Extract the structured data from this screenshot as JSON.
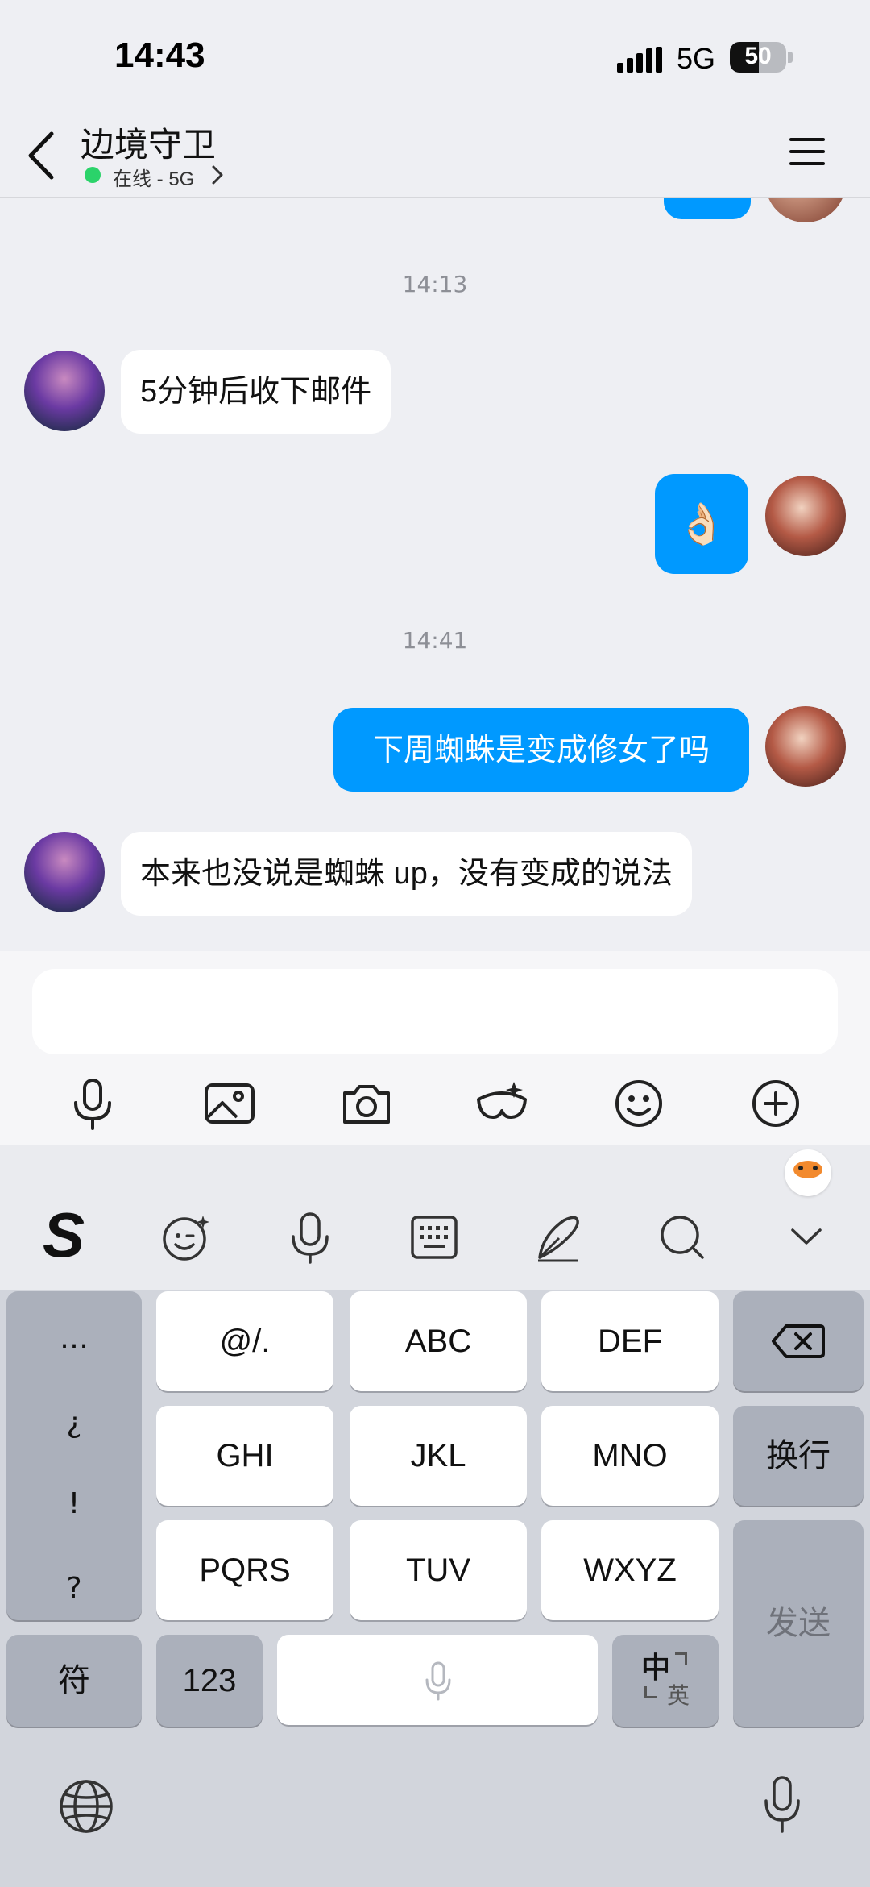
{
  "status": {
    "time": "14:43",
    "network": "5G",
    "battery": "50"
  },
  "header": {
    "title": "边境守卫",
    "status_text": "在线 - 5G"
  },
  "chat": {
    "time1": "14:13",
    "msg1": "5分钟后收下邮件",
    "msg2": "👌🏻",
    "time2": "14:41",
    "msg3": "下周蜘蛛是变成修女了吗",
    "msg4": "本来也没说是蜘蛛 up，没有变成的说法"
  },
  "input": {
    "placeholder": ""
  },
  "keyboard": {
    "symbols": [
      "…",
      "¿",
      "!",
      "?"
    ],
    "rows": [
      [
        "@/.",
        "ABC",
        "DEF"
      ],
      [
        "GHI",
        "JKL",
        "MNO"
      ],
      [
        "PQRS",
        "TUV",
        "WXYZ"
      ]
    ],
    "newline": "换行",
    "send": "发送",
    "fu": "符",
    "num": "123",
    "zh": "中",
    "en": "英",
    "brand_letter": "S"
  },
  "colors": {
    "accent": "#0099ff",
    "online": "#2bd36a",
    "background": "#eeeff3"
  }
}
